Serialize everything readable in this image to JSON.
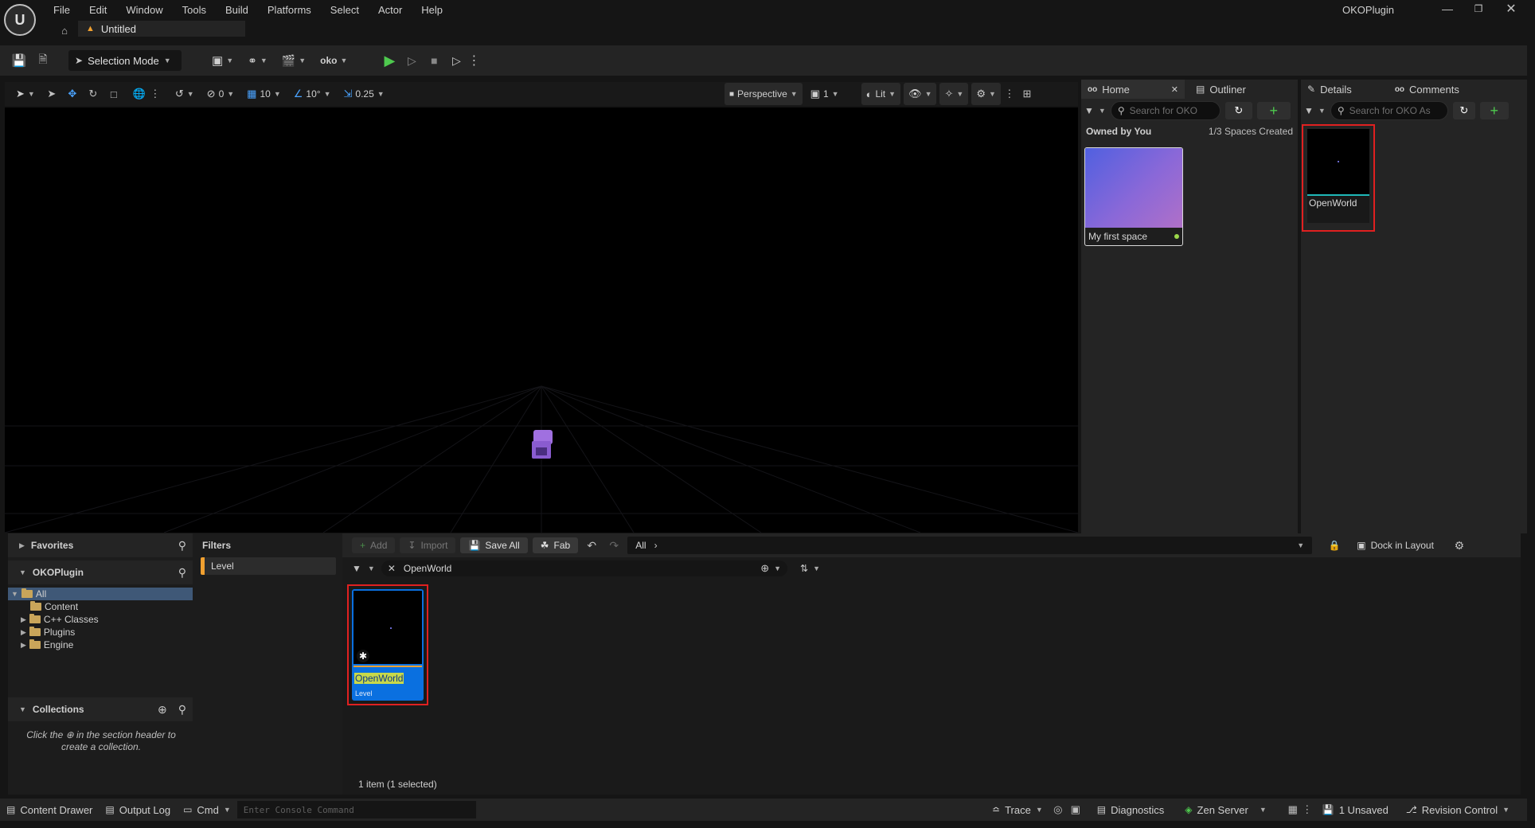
{
  "app": {
    "project_name": "OKOPlugin",
    "tab_title": "Untitled"
  },
  "menu": [
    "File",
    "Edit",
    "Window",
    "Tools",
    "Build",
    "Platforms",
    "Select",
    "Actor",
    "Help"
  ],
  "toolbar": {
    "selection_mode": "Selection Mode"
  },
  "viewport": {
    "snap_translate": "0",
    "grid_size": "10",
    "rotation_snap": "10°",
    "scale_snap": "0.25",
    "view_mode": "Perspective",
    "speed": "1",
    "lighting": "Lit"
  },
  "home_panel": {
    "tab_home": "Home",
    "tab_outliner": "Outliner",
    "search_placeholder": "Search for OKO",
    "owned_by": "Owned by You",
    "spaces_created": "1/3 Spaces Created",
    "space_name": "My first space"
  },
  "details_panel": {
    "tab_details": "Details",
    "tab_comments": "Comments",
    "search_placeholder": "Search for OKO As",
    "asset_name": "OpenWorld"
  },
  "content_browser": {
    "favorites": "Favorites",
    "project": "OKOPlugin",
    "tree": {
      "all": "All",
      "content": "Content",
      "cpp": "C++ Classes",
      "plugins": "Plugins",
      "engine": "Engine"
    },
    "collections": "Collections",
    "collections_hint_1": "Click the",
    "collections_hint_2": "in the section header to create a collection.",
    "filters": "Filters",
    "filter_level": "Level",
    "add": "Add",
    "import": "Import",
    "save_all": "Save All",
    "fab": "Fab",
    "path_all": "All",
    "search_value": "OpenWorld",
    "dock_in_layout": "Dock in Layout",
    "asset_name": "OpenWorld",
    "asset_type": "Level",
    "item_count": "1 item (1 selected)"
  },
  "status_bar": {
    "content_drawer": "Content Drawer",
    "output_log": "Output Log",
    "cmd": "Cmd",
    "console_placeholder": "Enter Console Command",
    "trace": "Trace",
    "diagnostics": "Diagnostics",
    "zen_server": "Zen Server",
    "unsaved": "1 Unsaved",
    "revision_control": "Revision Control"
  },
  "colors": {
    "accent_green": "#4ec94e",
    "selection_blue": "#0a70e0",
    "highlight_red": "#e02020",
    "level_orange": "#f0a030"
  }
}
